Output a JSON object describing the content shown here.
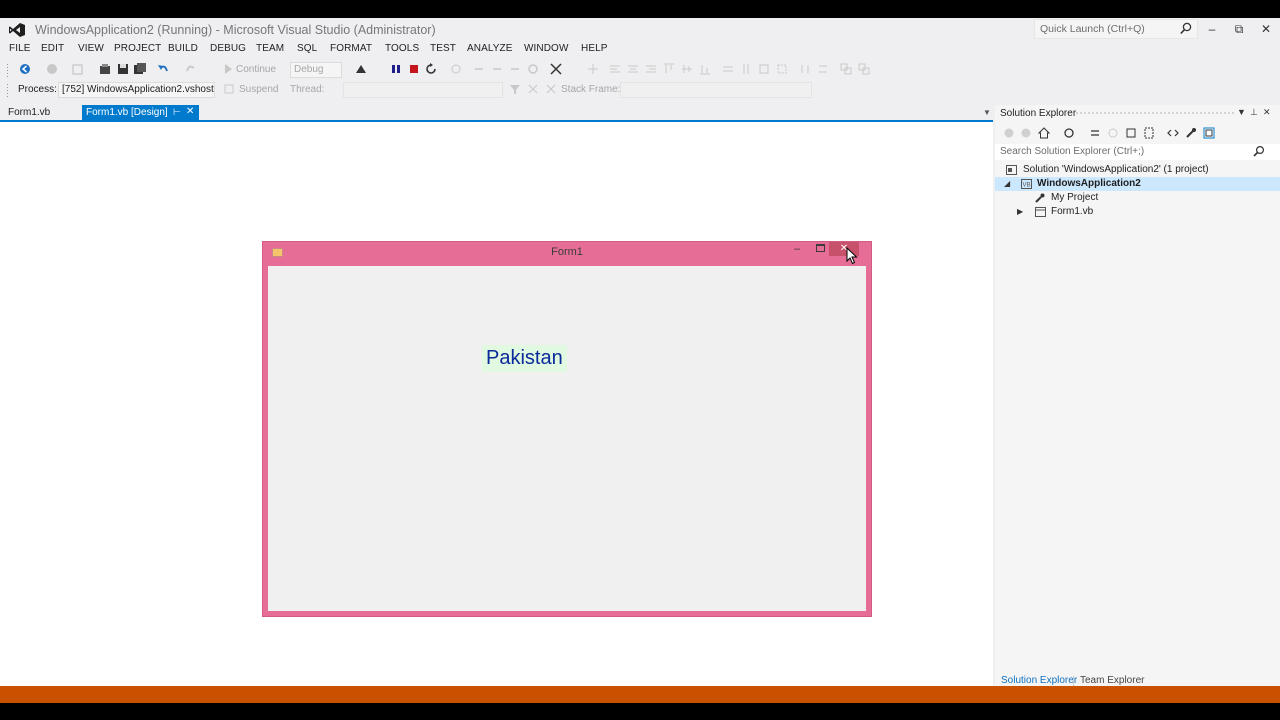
{
  "window": {
    "title": "WindowsApplication2 (Running) - Microsoft Visual Studio (Administrator)",
    "quick_launch_placeholder": "Quick Launch (Ctrl+Q)"
  },
  "menu": [
    "FILE",
    "EDIT",
    "VIEW",
    "PROJECT",
    "BUILD",
    "DEBUG",
    "TEAM",
    "SQL",
    "FORMAT",
    "TOOLS",
    "TEST",
    "ANALYZE",
    "WINDOW",
    "HELP"
  ],
  "toolbar": {
    "continue_label": "Continue",
    "config_value": "Debug",
    "process_label": "Process:",
    "process_value": "[752] WindowsApplication2.vshost",
    "suspend_label": "Suspend",
    "thread_label": "Thread:",
    "stack_frame_label": "Stack Frame:"
  },
  "tabs": [
    {
      "label": "Form1.vb",
      "active": false
    },
    {
      "label": "Form1.vb [Design]",
      "active": true
    }
  ],
  "form": {
    "title": "Form1",
    "label_text": "Pakistan",
    "label_color": "#0a2a9a",
    "label_background": "#e1f8e1",
    "title_bar_color": "#e66e96"
  },
  "solution_explorer": {
    "title": "Solution Explorer",
    "search_placeholder": "Search Solution Explorer (Ctrl+;)",
    "tree": [
      {
        "label": "Solution 'WindowsApplication2' (1 project)",
        "level": 0,
        "bold": false
      },
      {
        "label": "WindowsApplication2",
        "level": 1,
        "bold": true,
        "selected": true
      },
      {
        "label": "My Project",
        "level": 2,
        "bold": false
      },
      {
        "label": "Form1.vb",
        "level": 2,
        "bold": false
      }
    ],
    "bottom_tabs": [
      "Solution Explorer",
      "Team Explorer"
    ]
  },
  "colors": {
    "accent": "#007acc",
    "status_bar": "#ca5100",
    "background": "#efeff2"
  }
}
